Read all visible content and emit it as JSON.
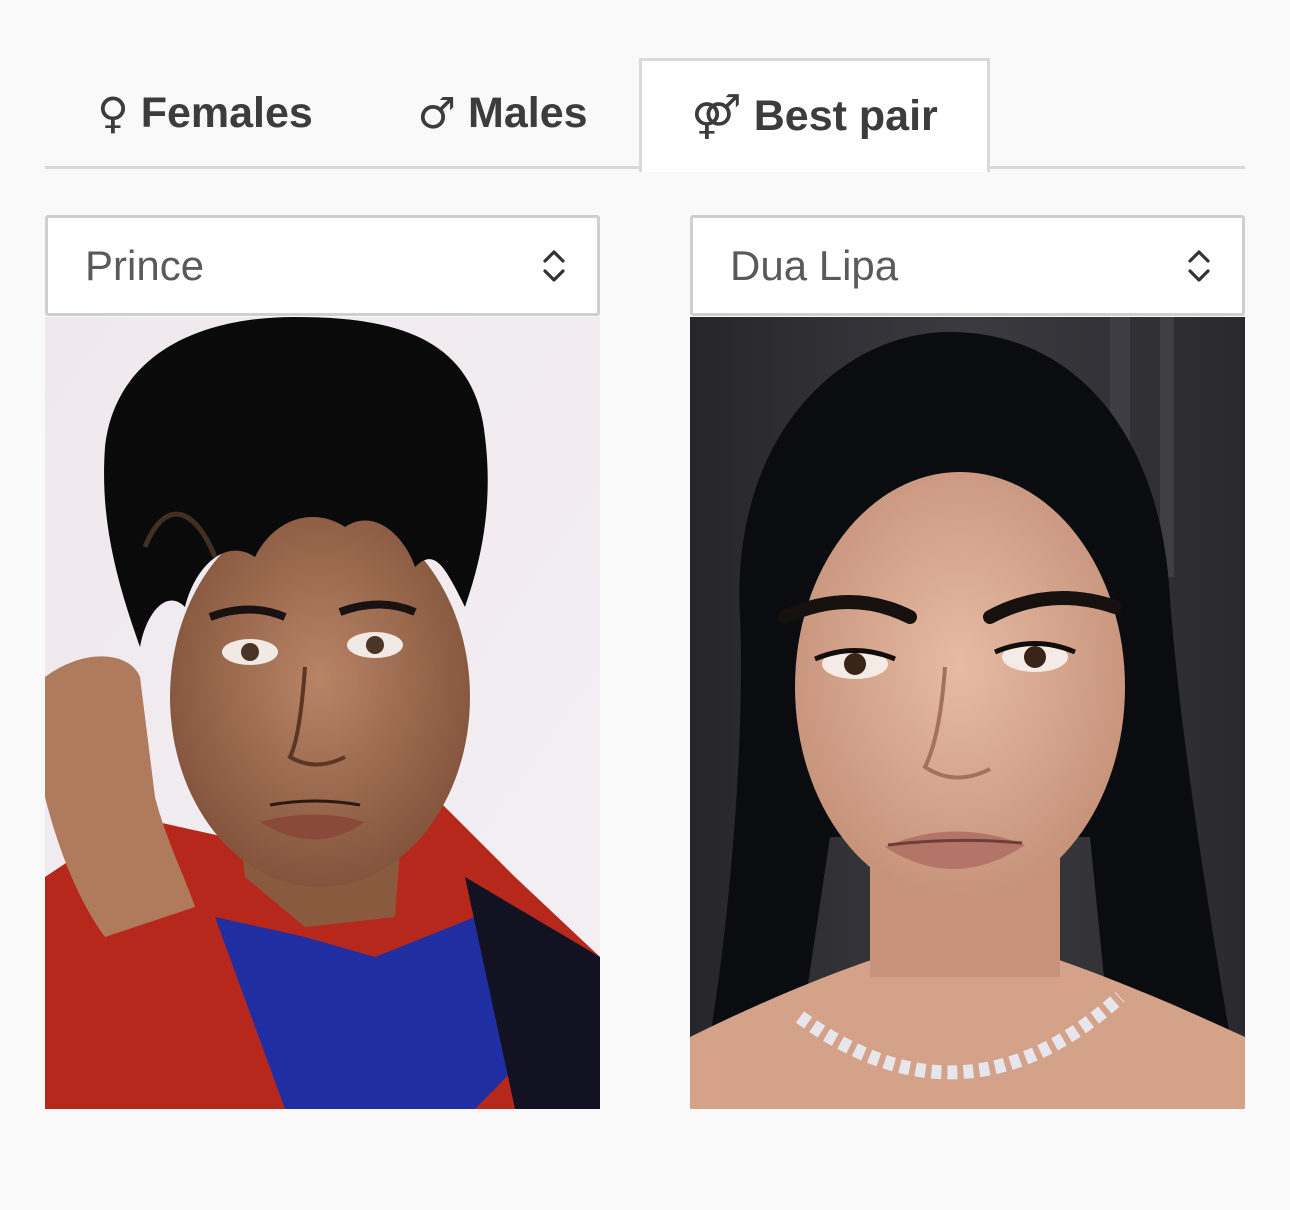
{
  "tabs": [
    {
      "label": "Females",
      "glyph": "♀",
      "icon": "female-symbol-icon",
      "active": false
    },
    {
      "label": "Males",
      "glyph": "♂",
      "icon": "male-symbol-icon",
      "active": false
    },
    {
      "label": "Best pair",
      "glyph": "⚤",
      "icon": "pair-symbol-icon",
      "active": true
    }
  ],
  "left": {
    "selected": "Prince",
    "icon": "chevron-up-down-icon",
    "photo": "portrait-photo"
  },
  "right": {
    "selected": "Dua Lipa",
    "icon": "chevron-up-down-icon",
    "photo": "portrait-photo"
  },
  "colors": {
    "page_background": "#f9f9f9",
    "tab_active_background": "#ffffff",
    "tab_border": "#d9d9d9",
    "text": "#3c3c3c",
    "select_text": "#5a5a5a"
  }
}
